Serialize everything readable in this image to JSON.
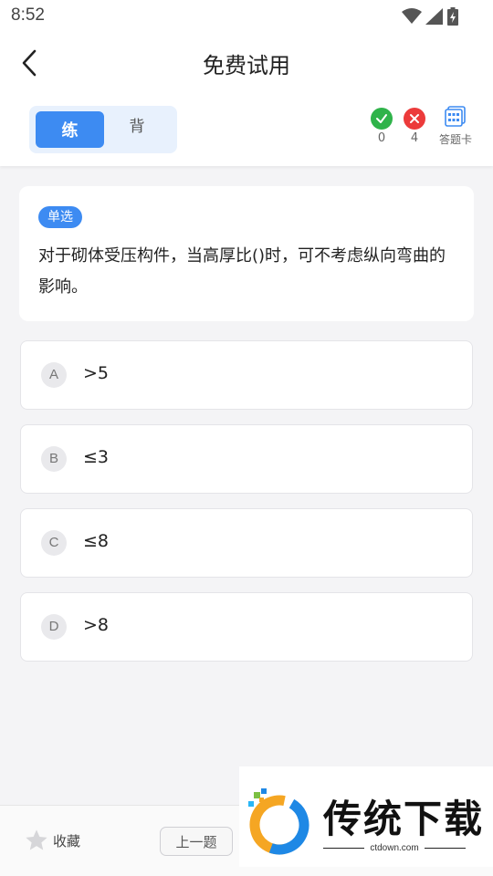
{
  "status_bar": {
    "time": "8:52"
  },
  "nav": {
    "title": "免费试用"
  },
  "mode": {
    "practice_label": "练",
    "recite_label": "背"
  },
  "stats": {
    "correct_count": "0",
    "wrong_count": "4",
    "answer_card_label": "答题卡"
  },
  "question": {
    "type_tag": "单选",
    "text": "对于砌体受压构件，当高厚比()时，可不考虑纵向弯曲的影响。"
  },
  "options": [
    {
      "letter": "A",
      "text": ">5"
    },
    {
      "letter": "B",
      "text": "≤3"
    },
    {
      "letter": "C",
      "text": "≤8"
    },
    {
      "letter": "D",
      "text": ">8"
    }
  ],
  "bottom": {
    "favorite_label": "收藏",
    "prev_label": "上一题"
  },
  "watermark": {
    "title": "传统下载",
    "url": "ctdown.com"
  },
  "colors": {
    "accent": "#3d8bf2",
    "correct": "#2fb34a",
    "wrong": "#ec3b3b"
  }
}
